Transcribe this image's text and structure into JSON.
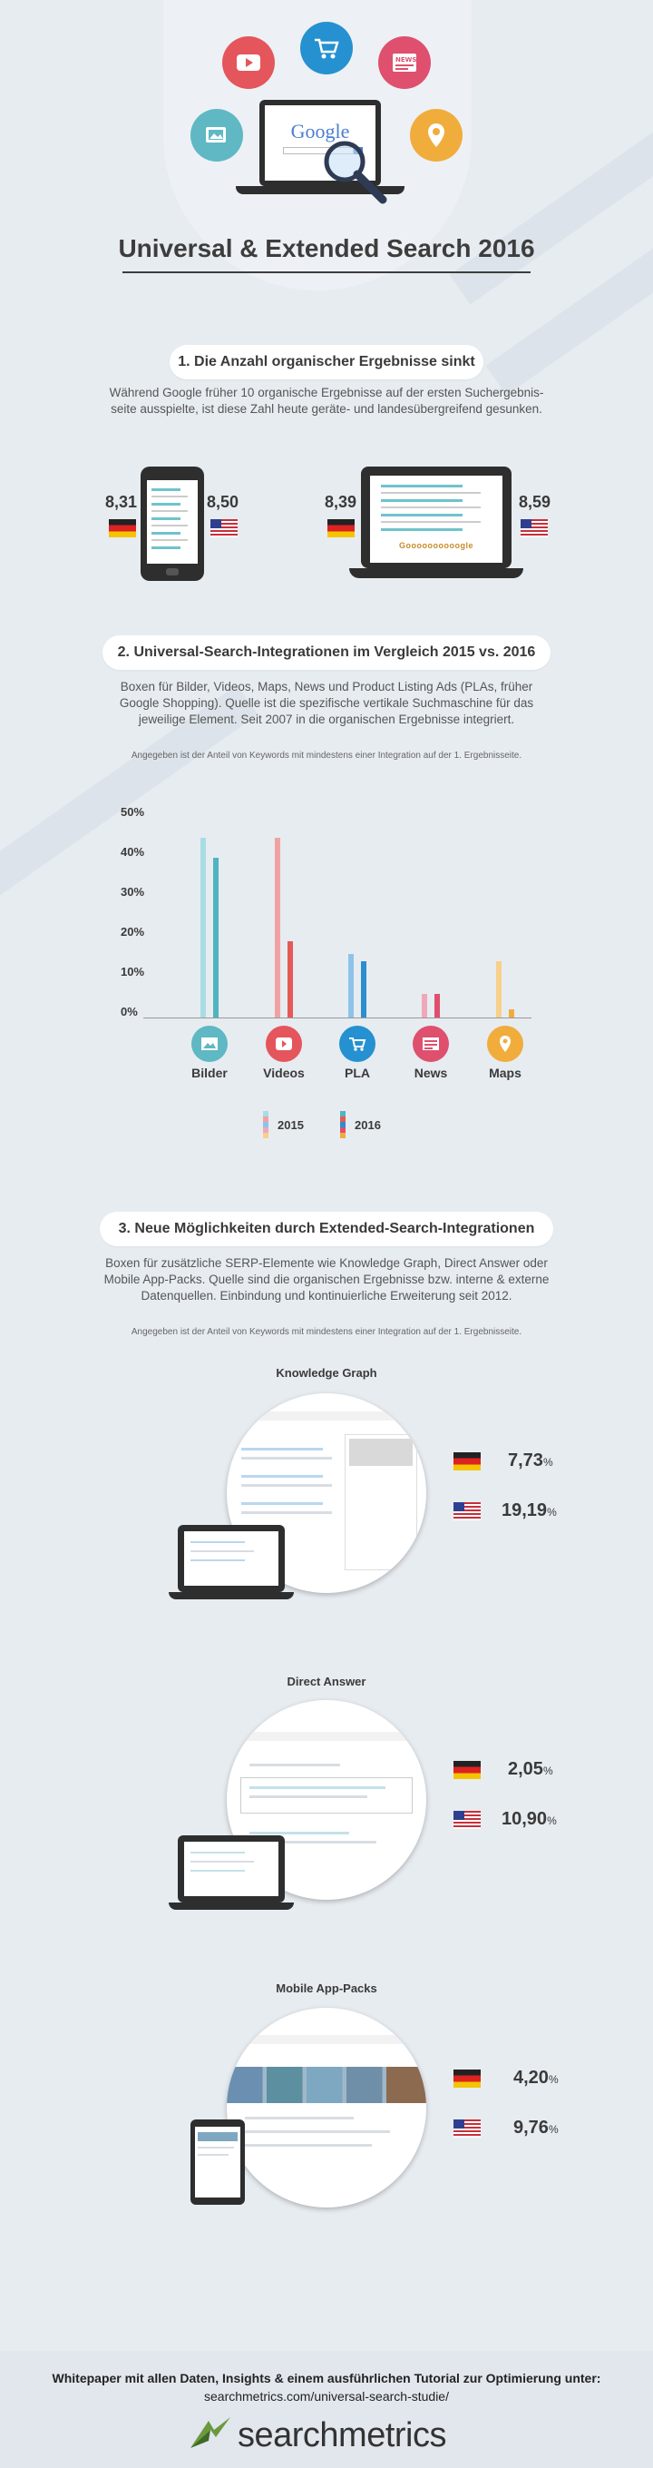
{
  "title": "Universal & Extended Search 2016",
  "hero": {
    "google_logo": "Google",
    "icons": [
      "image-icon",
      "video-icon",
      "shopping-cart-icon",
      "news-icon",
      "map-pin-icon"
    ]
  },
  "colors": {
    "teal": "#5fb8c4",
    "red": "#e4565c",
    "blue": "#2591d0",
    "pink": "#df4f6e",
    "orange": "#f0ad3c",
    "dark": "#3d3d3d"
  },
  "section1": {
    "heading": "1. Die Anzahl organischer Ergebnisse sinkt",
    "text": "Während Google früher 10 organische Ergebnisse auf der ersten Suchergebnis-seite ausspielte, ist diese Zahl heute geräte- und landesübergreifend gesunken.",
    "mobile_de": "8,31",
    "mobile_us": "8,50",
    "desktop_de": "8,39",
    "desktop_us": "8,59",
    "laptop_logo": "Goooooooooogle"
  },
  "section2": {
    "heading": "2. Universal-Search-Integrationen im Vergleich 2015 vs. 2016",
    "text": "Boxen für Bilder, Videos, Maps, News und Product Listing Ads (PLAs, früher Google Shopping). Quelle ist die spezifische vertikale Suchmaschine für das jeweilige Element. Seit 2007 in die organischen Ergebnisse integriert.",
    "note": "Angegeben ist der Anteil von Keywords mit mindestens einer Integration auf der 1. Ergebnisseite.",
    "legend_2015": "2015",
    "legend_2016": "2016"
  },
  "chart_data": {
    "type": "bar",
    "categories": [
      "Bilder",
      "Videos",
      "PLA",
      "News",
      "Maps"
    ],
    "series": [
      {
        "name": "2015",
        "values": [
          45,
          45,
          16,
          6,
          14
        ]
      },
      {
        "name": "2016",
        "values": [
          40,
          19,
          14,
          6,
          2
        ]
      }
    ],
    "ylim": [
      0,
      50
    ],
    "yticks": [
      "0%",
      "10%",
      "20%",
      "30%",
      "40%",
      "50%"
    ],
    "colors_2015": [
      "#a8dde4",
      "#f0a2a2",
      "#8dc3ea",
      "#f0a8b8",
      "#f7d08a"
    ],
    "colors_2016": [
      "#4fb5c0",
      "#e65a55",
      "#2b8fcf",
      "#df4f6e",
      "#f0ad3c"
    ]
  },
  "section3": {
    "heading": "3. Neue Möglichkeiten durch Extended-Search-Integrationen",
    "text": "Boxen für zusätzliche SERP-Elemente wie Knowledge Graph, Direct Answer oder Mobile App-Packs. Quelle sind die organischen Ergebnisse bzw. interne & externe Datenquellen. Einbindung und kontinuierliche Erweiterung seit 2012.",
    "note": "Angegeben ist der Anteil von Keywords mit mindestens einer Integration auf der 1. Ergebnisseite.",
    "items": [
      {
        "title": "Knowledge Graph",
        "de": "7,73",
        "us": "19,19"
      },
      {
        "title": "Direct Answer",
        "de": "2,05",
        "us": "10,90"
      },
      {
        "title": "Mobile App-Packs",
        "de": "4,20",
        "us": "9,76"
      }
    ],
    "pct_sign": "%"
  },
  "footer": {
    "line1": "Whitepaper mit allen Daten, Insights & einem ausführlichen Tutorial zur Optimierung unter:",
    "line2": "searchmetrics.com/universal-search-studie/",
    "logo": "searchmetrics"
  }
}
